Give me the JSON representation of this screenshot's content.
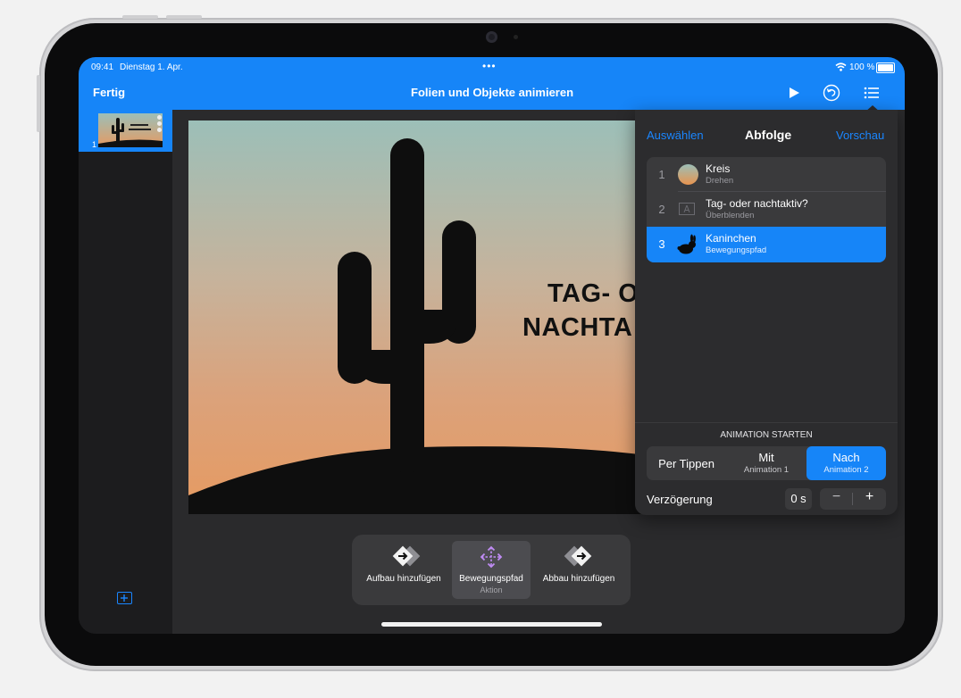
{
  "status_bar": {
    "time": "09:41",
    "date": "Dienstag 1. Apr.",
    "dots": "•••",
    "battery": "100 %"
  },
  "nav": {
    "done_label": "Fertig",
    "title": "Folien und Objekte animieren"
  },
  "slides": [
    {
      "number": "1"
    }
  ],
  "slide": {
    "title_line1": "TAG- O",
    "title_line2": "NACHTA"
  },
  "panel": {
    "select_label": "Auswählen",
    "title": "Abfolge",
    "preview_label": "Vorschau",
    "items": [
      {
        "number": "1",
        "name": "Kreis",
        "effect": "Drehen"
      },
      {
        "number": "2",
        "name": "Tag- oder nachtaktiv?",
        "effect": "Überblenden"
      },
      {
        "number": "3",
        "name": "Kaninchen",
        "effect": "Bewegungspfad"
      }
    ],
    "start_heading": "ANIMATION STARTEN",
    "start_options": [
      {
        "label": "Per Tippen",
        "sub": ""
      },
      {
        "label": "Mit",
        "sub": "Animation 1"
      },
      {
        "label": "Nach",
        "sub": "Animation 2"
      }
    ],
    "delay_label": "Verzögerung",
    "delay_value": "0 s",
    "minus": "−",
    "plus": "+"
  },
  "toolbar": {
    "build_in": "Aufbau hinzufügen",
    "motion": "Bewegungspfad",
    "motion_sub": "Aktion",
    "build_out": "Abbau hinzufügen"
  },
  "colors": {
    "accent": "#1685f8",
    "panel": "#2c2c2e",
    "selected_row": "#1685f8"
  }
}
